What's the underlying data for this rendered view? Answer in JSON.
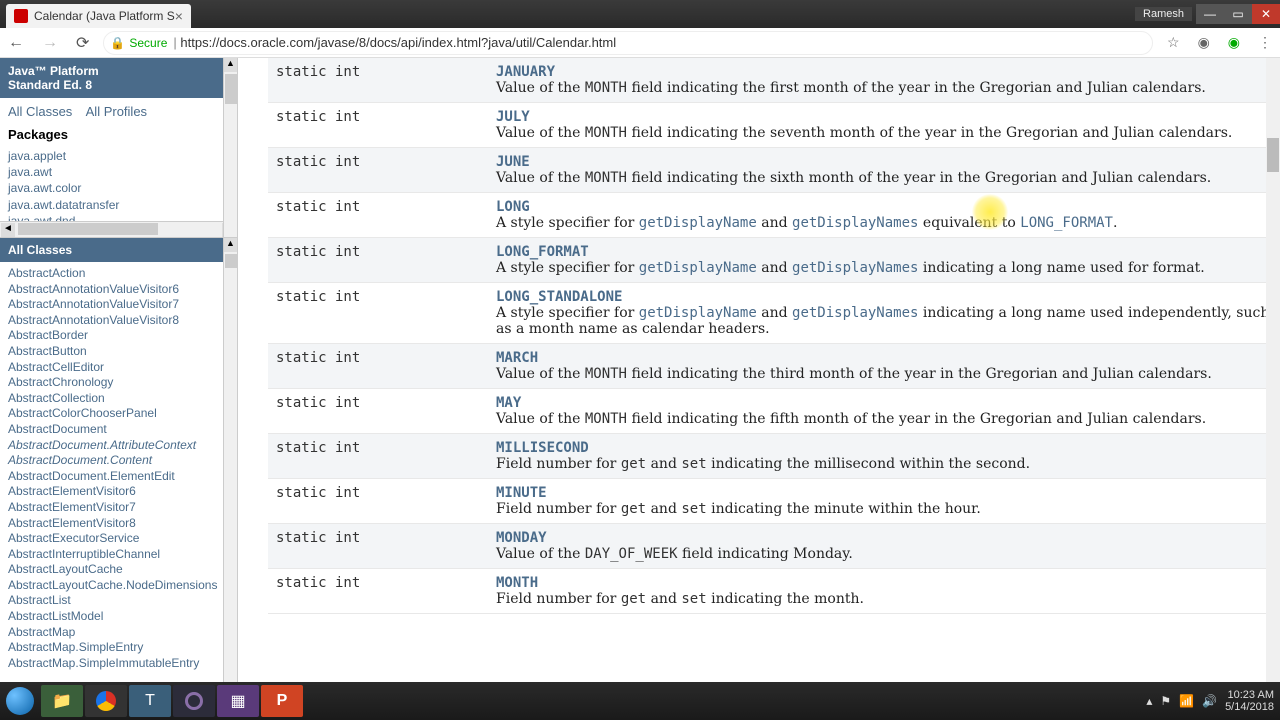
{
  "window": {
    "user": "Ramesh"
  },
  "tab": {
    "title": "Calendar (Java Platform S"
  },
  "url": {
    "secure_label": "Secure",
    "text": "https://docs.oracle.com/javase/8/docs/api/index.html?java/util/Calendar.html"
  },
  "taskbar": {
    "time": "10:23 AM",
    "date": "5/14/2018"
  },
  "topframe": {
    "title_line1": "Java™ Platform",
    "title_line2": "Standard Ed. 8",
    "all_classes": "All Classes",
    "all_profiles": "All Profiles",
    "packages_heading": "Packages",
    "packages": [
      "java.applet",
      "java.awt",
      "java.awt.color",
      "java.awt.datatransfer",
      "java.awt.dnd"
    ]
  },
  "botframe": {
    "heading": "All Classes",
    "classes": [
      {
        "n": "AbstractAction",
        "i": false
      },
      {
        "n": "AbstractAnnotationValueVisitor6",
        "i": false
      },
      {
        "n": "AbstractAnnotationValueVisitor7",
        "i": false
      },
      {
        "n": "AbstractAnnotationValueVisitor8",
        "i": false
      },
      {
        "n": "AbstractBorder",
        "i": false
      },
      {
        "n": "AbstractButton",
        "i": false
      },
      {
        "n": "AbstractCellEditor",
        "i": false
      },
      {
        "n": "AbstractChronology",
        "i": false
      },
      {
        "n": "AbstractCollection",
        "i": false
      },
      {
        "n": "AbstractColorChooserPanel",
        "i": false
      },
      {
        "n": "AbstractDocument",
        "i": false
      },
      {
        "n": "AbstractDocument.AttributeContext",
        "i": true
      },
      {
        "n": "AbstractDocument.Content",
        "i": true
      },
      {
        "n": "AbstractDocument.ElementEdit",
        "i": false
      },
      {
        "n": "AbstractElementVisitor6",
        "i": false
      },
      {
        "n": "AbstractElementVisitor7",
        "i": false
      },
      {
        "n": "AbstractElementVisitor8",
        "i": false
      },
      {
        "n": "AbstractExecutorService",
        "i": false
      },
      {
        "n": "AbstractInterruptibleChannel",
        "i": false
      },
      {
        "n": "AbstractLayoutCache",
        "i": false
      },
      {
        "n": "AbstractLayoutCache.NodeDimensions",
        "i": false
      },
      {
        "n": "AbstractList",
        "i": false
      },
      {
        "n": "AbstractListModel",
        "i": false
      },
      {
        "n": "AbstractMap",
        "i": false
      },
      {
        "n": "AbstractMap.SimpleEntry",
        "i": false
      },
      {
        "n": "AbstractMap.SimpleImmutableEntry",
        "i": false
      }
    ]
  },
  "fields": [
    {
      "type": "static int",
      "name": "JANUARY",
      "desc_pre": "Value of the ",
      "code1": "MONTH",
      "desc_mid": " field indicating the first month of the year in the Gregorian and Julian calendars.",
      "kind": "month"
    },
    {
      "type": "static int",
      "name": "JULY",
      "desc_pre": "Value of the ",
      "code1": "MONTH",
      "desc_mid": " field indicating the seventh month of the year in the Gregorian and Julian calendars.",
      "kind": "month"
    },
    {
      "type": "static int",
      "name": "JUNE",
      "desc_pre": "Value of the ",
      "code1": "MONTH",
      "desc_mid": " field indicating the sixth month of the year in the Gregorian and Julian calendars.",
      "kind": "month"
    },
    {
      "type": "static int",
      "name": "LONG",
      "desc_pre": "A style specifier for ",
      "link1": "getDisplayName",
      "mid1": " and ",
      "link2": "getDisplayNames",
      "desc_mid": " equivalent to ",
      "code1": "LONG_FORMAT",
      "desc_post": ".",
      "kind": "style"
    },
    {
      "type": "static int",
      "name": "LONG_FORMAT",
      "desc_pre": "A style specifier for ",
      "link1": "getDisplayName",
      "mid1": " and ",
      "link2": "getDisplayNames",
      "desc_mid": " indicating a long name used for format.",
      "kind": "style"
    },
    {
      "type": "static int",
      "name": "LONG_STANDALONE",
      "desc_pre": "A style specifier for ",
      "link1": "getDisplayName",
      "mid1": " and ",
      "link2": "getDisplayNames",
      "desc_mid": " indicating a long name used independently, such as a month name as calendar headers.",
      "kind": "style"
    },
    {
      "type": "static int",
      "name": "MARCH",
      "desc_pre": "Value of the ",
      "code1": "MONTH",
      "desc_mid": " field indicating the third month of the year in the Gregorian and Julian calendars.",
      "kind": "month"
    },
    {
      "type": "static int",
      "name": "MAY",
      "desc_pre": "Value of the ",
      "code1": "MONTH",
      "desc_mid": " field indicating the fifth month of the year in the Gregorian and Julian calendars.",
      "kind": "month"
    },
    {
      "type": "static int",
      "name": "MILLISECOND",
      "desc_pre": "Field number for ",
      "code1": "get",
      "mid1": " and ",
      "code2": "set",
      "desc_mid": " indicating the millisecond within the second.",
      "kind": "field"
    },
    {
      "type": "static int",
      "name": "MINUTE",
      "desc_pre": "Field number for ",
      "code1": "get",
      "mid1": " and ",
      "code2": "set",
      "desc_mid": " indicating the minute within the hour.",
      "kind": "field"
    },
    {
      "type": "static int",
      "name": "MONDAY",
      "desc_pre": "Value of the ",
      "code1": "DAY_OF_WEEK",
      "desc_mid": " field indicating Monday.",
      "kind": "month"
    },
    {
      "type": "static int",
      "name": "MONTH",
      "desc_pre": "Field number for ",
      "code1": "get",
      "mid1": " and ",
      "code2": "set",
      "desc_mid": " indicating the month.",
      "kind": "field"
    }
  ]
}
